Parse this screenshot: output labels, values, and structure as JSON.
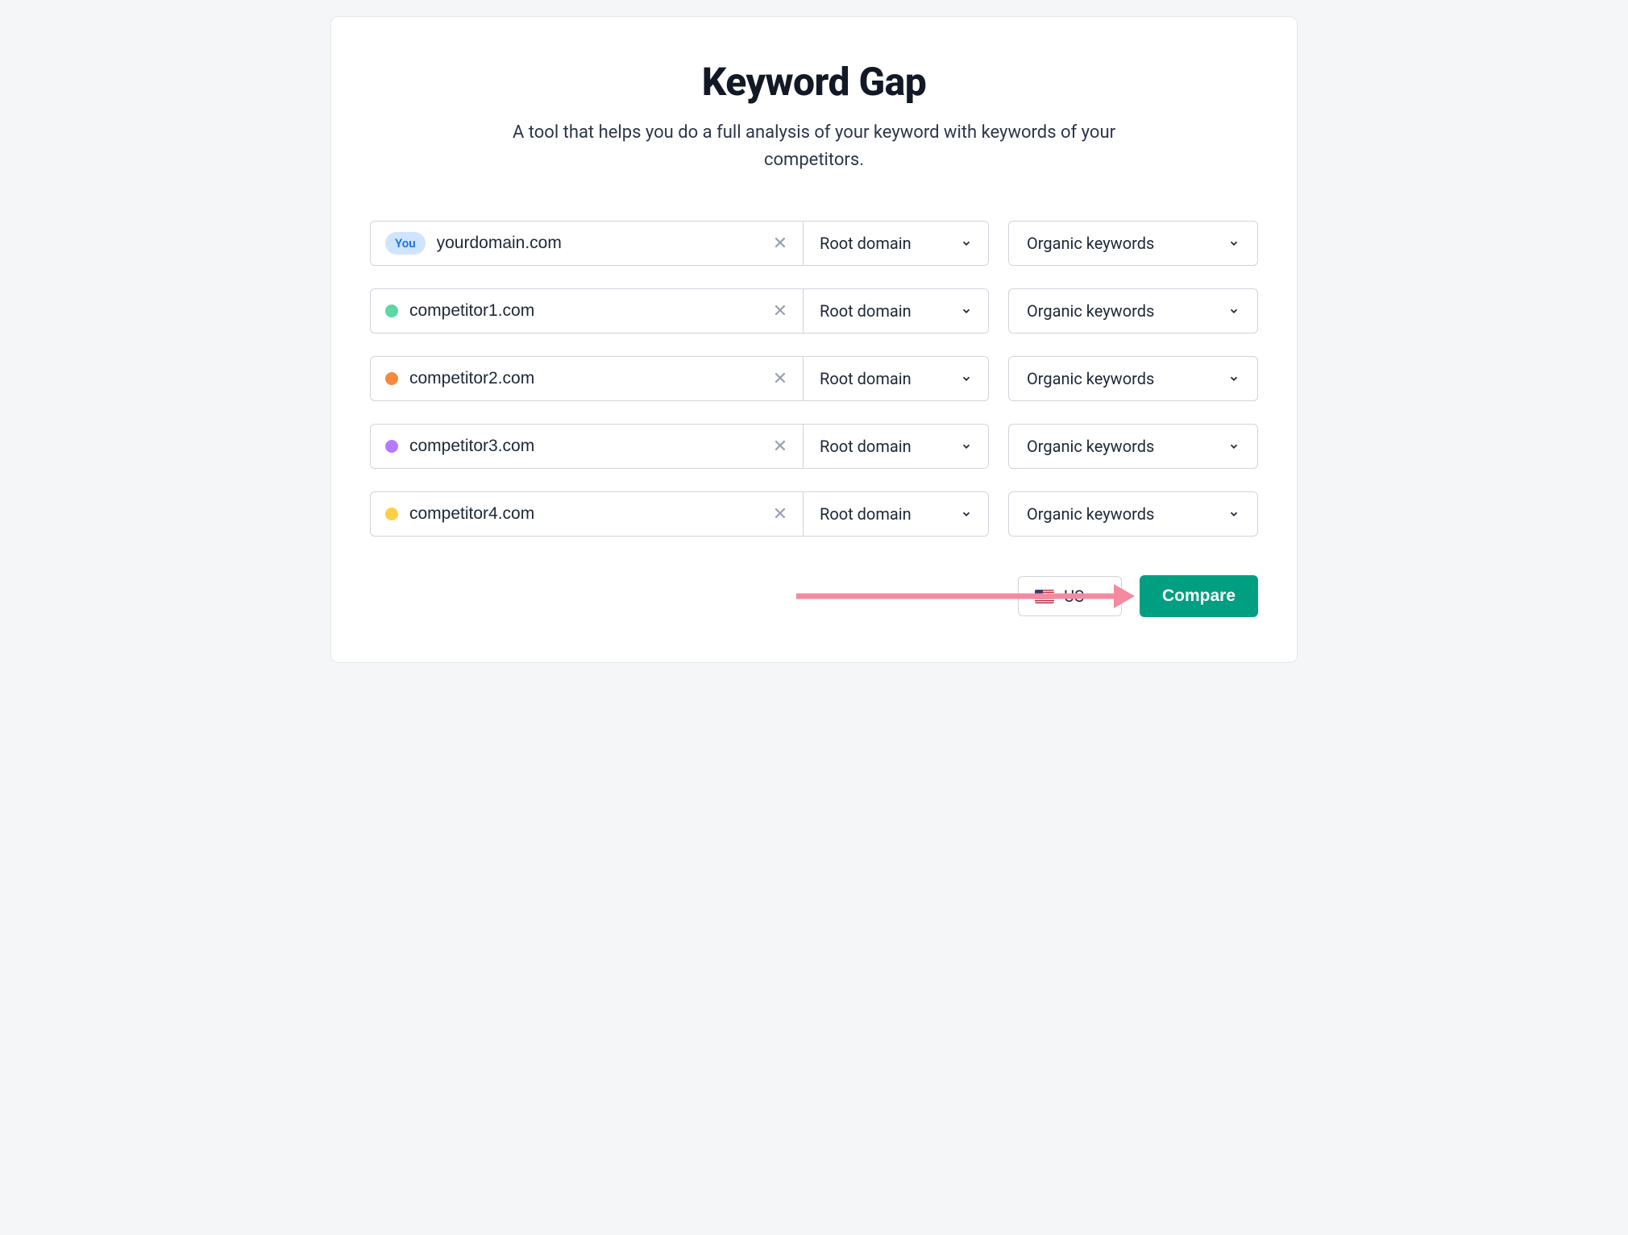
{
  "header": {
    "title": "Keyword Gap",
    "subtitle": "A tool that helps you do a full analysis of your keyword with keywords of your competitors."
  },
  "badges": {
    "you": "You"
  },
  "rows": [
    {
      "domain": "yourdomain.com",
      "dot_color": null,
      "scope": "Root domain",
      "kw_type": "Organic keywords",
      "is_you": true
    },
    {
      "domain": "competitor1.com",
      "dot_color": "#5ed6a6",
      "scope": "Root domain",
      "kw_type": "Organic keywords",
      "is_you": false
    },
    {
      "domain": "competitor2.com",
      "dot_color": "#f48b3c",
      "scope": "Root domain",
      "kw_type": "Organic keywords",
      "is_you": false
    },
    {
      "domain": "competitor3.com",
      "dot_color": "#b57bff",
      "scope": "Root domain",
      "kw_type": "Organic keywords",
      "is_you": false
    },
    {
      "domain": "competitor4.com",
      "dot_color": "#ffcf47",
      "scope": "Root domain",
      "kw_type": "Organic keywords",
      "is_you": false
    }
  ],
  "footer": {
    "country_code": "US",
    "compare_label": "Compare"
  },
  "annotation": {
    "arrow_color": "#f48aa0"
  }
}
